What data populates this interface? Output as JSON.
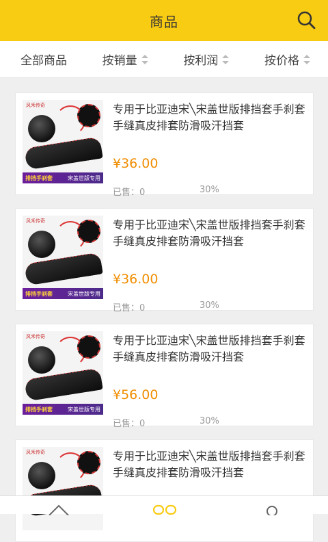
{
  "header": {
    "title": "商品"
  },
  "sort_bar": {
    "items": [
      {
        "label": "全部商品"
      },
      {
        "label": "按销量"
      },
      {
        "label": "按利润"
      },
      {
        "label": "按价格"
      }
    ]
  },
  "products": [
    {
      "name": "专用于比亚迪宋╲宋盖世版排挡套手刹套手缝真皮排套防滑吸汗挡套",
      "price": "¥36.00",
      "sold": "已售：0",
      "rate": "30%",
      "thumb_brand": "风禾传奇",
      "thumb_banner_left": "排挡手刹套",
      "thumb_banner_right": "宋盖世版专用"
    },
    {
      "name": "专用于比亚迪宋╲宋盖世版排挡套手刹套手缝真皮排套防滑吸汗挡套",
      "price": "¥36.00",
      "sold": "已售：0",
      "rate": "30%",
      "thumb_brand": "风禾传奇",
      "thumb_banner_left": "排挡手刹套",
      "thumb_banner_right": "宋盖世版专用"
    },
    {
      "name": "专用于比亚迪宋╲宋盖世版排挡套手刹套手缝真皮排套防滑吸汗挡套",
      "price": "¥56.00",
      "sold": "已售：0",
      "rate": "30%",
      "thumb_brand": "风禾传奇",
      "thumb_banner_left": "排挡手刹套",
      "thumb_banner_right": "宋盖世版专用"
    },
    {
      "name": "专用于比亚迪宋╲宋盖世版排挡套手刹套手缝真皮排套防滑吸汗挡套",
      "price": "",
      "sold": "",
      "rate": "",
      "thumb_brand": "风禾传奇",
      "thumb_banner_left": "",
      "thumb_banner_right": ""
    }
  ],
  "tabbar": {
    "icons": [
      "home-icon",
      "products-icon",
      "profile-icon"
    ],
    "active_color": "#f9cc14"
  },
  "colors": {
    "header_bg": "#f9cc14",
    "price": "#f08d00"
  }
}
